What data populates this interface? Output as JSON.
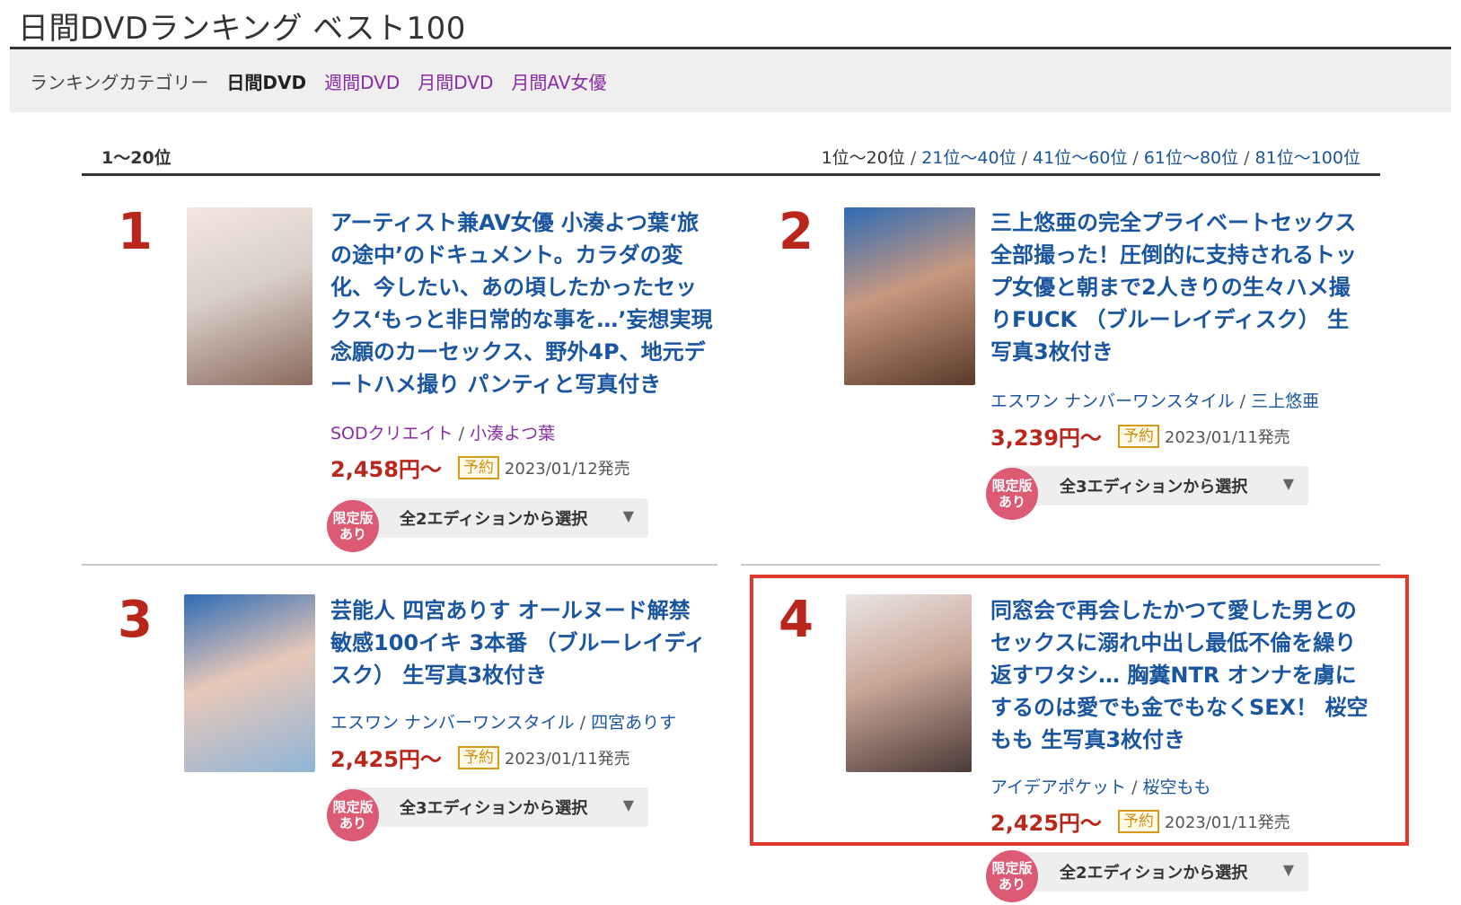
{
  "page": {
    "title": "日間DVDランキング ベスト100"
  },
  "category": {
    "label": "ランキングカテゴリー",
    "items": [
      "日間DVD",
      "週間DVD",
      "月間DVD",
      "月間AV女優"
    ]
  },
  "range": {
    "current": "1〜20位",
    "links": [
      "1位〜20位",
      "21位〜40位",
      "41位〜60位",
      "61位〜80位",
      "81位〜100位"
    ]
  },
  "items": [
    {
      "rank": "1",
      "title": [
        "アーティスト兼AV女優 小湊よつ葉‘旅",
        "の途中’のドキュメント。カラダの変",
        "化、今したい、あの頃したかったセッ",
        "クス‘もっと非日常的な事を…’妄想実現",
        "念願のカーセックス、野外4P、地元デ",
        "ートハメ撮り パンティと写真付き"
      ],
      "maker": "SODクリエイト",
      "actress": "小湊よつ葉",
      "price": "2,458円〜",
      "badge": "予約",
      "release": "2023/01/12発売",
      "limited": [
        "限定版",
        "あり"
      ],
      "edition": "全2エディションから選択",
      "cover_colors": [
        "#f4e6e0",
        "#8a6a5e",
        "#d9cfc8"
      ]
    },
    {
      "rank": "2",
      "title": [
        "三上悠亜の完全プライベートセックス",
        "全部撮った！圧倒的に支持されるトッ",
        "プ女優と朝まで2人きりの生々ハメ撮",
        "りFUCK （ブルーレイディスク） 生",
        "写真3枚付き"
      ],
      "maker": "エスワン ナンバーワンスタイル",
      "actress": "三上悠亜",
      "price": "3,239円〜",
      "badge": "予約",
      "release": "2023/01/11発売",
      "limited": [
        "限定版",
        "あり"
      ],
      "edition": "全3エディションから選択",
      "cover_colors": [
        "#2d6bb5",
        "#5a3a2a",
        "#c89880"
      ]
    },
    {
      "rank": "3",
      "title": [
        "芸能人 四宮ありす オールヌード解禁",
        "敏感100イキ 3本番 （ブルーレイディ",
        "スク） 生写真3枚付き"
      ],
      "maker": "エスワン ナンバーワンスタイル",
      "actress": "四宮ありす",
      "price": "2,425円〜",
      "badge": "予約",
      "release": "2023/01/11発売",
      "limited": [
        "限定版",
        "あり"
      ],
      "edition": "全3エディションから選択",
      "cover_colors": [
        "#2d6bb5",
        "#8fb5d8",
        "#e8c8b8"
      ]
    },
    {
      "rank": "4",
      "title": [
        "同窓会で再会したかつて愛した男との",
        "セックスに溺れ中出し最低不倫を繰り",
        "返すワタシ… 胸糞NTR オンナを虜に",
        "するのは愛でも金でもなくSEX！ 桜空",
        "もも 生写真3枚付き"
      ],
      "maker": "アイデアポケット",
      "actress": "桜空もも",
      "price": "2,425円〜",
      "badge": "予約",
      "release": "2023/01/11発売",
      "limited": [
        "限定版",
        "あり"
      ],
      "edition": "全2エディションから選択",
      "cover_colors": [
        "#e9e4e2",
        "#4a3a36",
        "#c9a698"
      ]
    }
  ]
}
